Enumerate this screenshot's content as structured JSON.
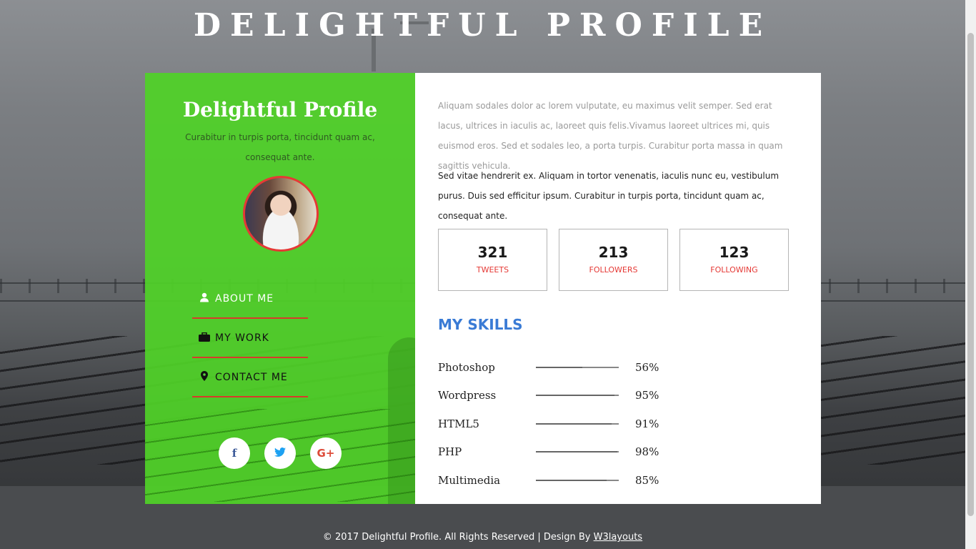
{
  "page": {
    "title": "DELIGHTFUL PROFILE"
  },
  "profile": {
    "name": "Delightful Profile",
    "tagline": "Curabitur in turpis porta, tincidunt quam ac, consequat ante."
  },
  "nav": [
    {
      "label": "ABOUT ME",
      "icon": "user-icon"
    },
    {
      "label": "MY WORK",
      "icon": "briefcase-icon"
    },
    {
      "label": "CONTACT ME",
      "icon": "map-marker-icon"
    }
  ],
  "social": [
    {
      "glyph": "f",
      "icon": "facebook-icon",
      "color": "#3b5998"
    },
    {
      "glyph": "🐦",
      "icon": "twitter-icon",
      "color": "#1da1f2"
    },
    {
      "glyph": "G+",
      "icon": "google-plus-icon",
      "color": "#dd4b39"
    }
  ],
  "about": {
    "para1": "Aliquam sodales dolor ac lorem vulputate, eu maximus velit semper. Sed erat lacus, ultrices in iaculis ac, laoreet quis felis.Vivamus laoreet ultrices mi, quis euismod eros. Sed et sodales leo, a porta turpis. Curabitur porta massa in quam sagittis vehicula.",
    "para2": "Sed vitae hendrerit ex. Aliquam in tortor venenatis, iaculis nunc eu, vestibulum purus. Duis sed efficitur ipsum. Curabitur in turpis porta, tincidunt quam ac, consequat ante."
  },
  "stats": [
    {
      "value": "321",
      "label": "TWEETS"
    },
    {
      "value": "213",
      "label": "FOLLOWERS"
    },
    {
      "value": "123",
      "label": "FOLLOWING"
    }
  ],
  "skills": {
    "title": "MY SKILLS",
    "items": [
      {
        "name": "Photoshop",
        "percent": "56%",
        "level": 0.56
      },
      {
        "name": "Wordpress",
        "percent": "95%",
        "level": 0.95
      },
      {
        "name": "HTML5",
        "percent": "91%",
        "level": 0.91
      },
      {
        "name": "PHP",
        "percent": "98%",
        "level": 0.98
      },
      {
        "name": "Multimedia",
        "percent": "85%",
        "level": 0.85
      }
    ]
  },
  "footer": {
    "text": "© 2017 Delightful Profile. All Rights Reserved | Design By ",
    "link": "W3layouts"
  },
  "colors": {
    "accent_green": "#55d23b",
    "accent_red": "#e53935",
    "heading_blue": "#3a7bd5"
  }
}
